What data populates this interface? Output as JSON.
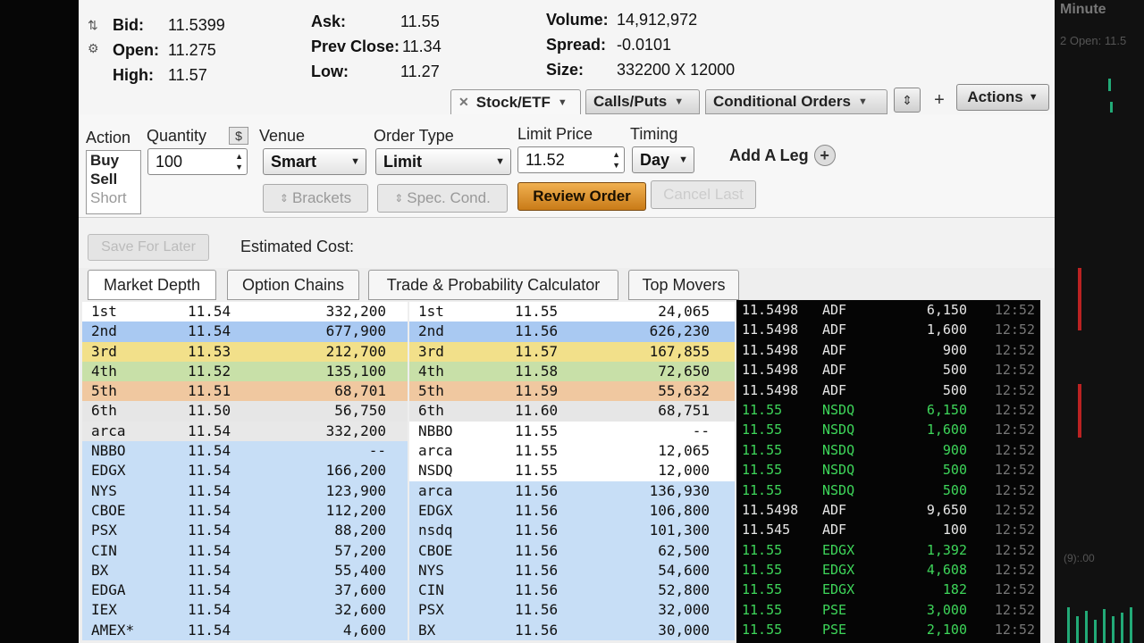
{
  "quote": {
    "bid_label": "Bid:",
    "bid": "11.5399",
    "open_label": "Open:",
    "open": "11.275",
    "high_label": "High:",
    "high": "11.57",
    "ask_label": "Ask:",
    "ask": "11.55",
    "prev_close_label": "Prev Close:",
    "prev_close": "11.34",
    "low_label": "Low:",
    "low": "11.27",
    "volume_label": "Volume:",
    "volume": "14,912,972",
    "spread_label": "Spread:",
    "spread": "-0.0101",
    "size_label": "Size:",
    "size": "332200 X 12000"
  },
  "tabs": {
    "stock_etf": "Stock/ETF",
    "calls_puts": "Calls/Puts",
    "conditional_orders": "Conditional Orders",
    "actions": "Actions"
  },
  "order": {
    "action_label": "Action",
    "quantity_label": "Quantity",
    "venue_label": "Venue",
    "order_type_label": "Order Type",
    "limit_price_label": "Limit Price",
    "timing_label": "Timing",
    "actions": [
      "Buy",
      "Sell",
      "Short"
    ],
    "quantity": "100",
    "venue": "Smart",
    "order_type": "Limit",
    "limit_price": "11.52",
    "timing": "Day",
    "add_leg": "Add A Leg",
    "brackets": "Brackets",
    "spec_cond": "Spec. Cond.",
    "review_order": "Review Order",
    "cancel_last": "Cancel Last",
    "save_for_later": "Save For Later",
    "estimated_cost": "Estimated Cost:"
  },
  "tool_tabs": [
    "Market Depth",
    "Option Chains",
    "Trade & Probability Calculator",
    "Top Movers"
  ],
  "bid_depth": [
    {
      "venue": "1st",
      "price": "11.54",
      "size": "332,200",
      "lvl": "lvl0"
    },
    {
      "venue": "2nd",
      "price": "11.54",
      "size": "677,900",
      "lvl": "lvl1"
    },
    {
      "venue": "3rd",
      "price": "11.53",
      "size": "212,700",
      "lvl": "lvl2"
    },
    {
      "venue": "4th",
      "price": "11.52",
      "size": "135,100",
      "lvl": "lvl3"
    },
    {
      "venue": "5th",
      "price": "11.51",
      "size": "68,701",
      "lvl": "lvl4"
    },
    {
      "venue": "6th",
      "price": "11.50",
      "size": "56,750",
      "lvl": "lvl5"
    },
    {
      "venue": "arca",
      "price": "11.54",
      "size": "332,200",
      "lvl": "ex-first"
    },
    {
      "venue": "NBBO",
      "price": "11.54",
      "size": "--",
      "lvl": "ex-bg"
    },
    {
      "venue": "EDGX",
      "price": "11.54",
      "size": "166,200",
      "lvl": "ex-bg"
    },
    {
      "venue": "NYS",
      "price": "11.54",
      "size": "123,900",
      "lvl": "ex-bg"
    },
    {
      "venue": "CBOE",
      "price": "11.54",
      "size": "112,200",
      "lvl": "ex-bg"
    },
    {
      "venue": "PSX",
      "price": "11.54",
      "size": "88,200",
      "lvl": "ex-bg"
    },
    {
      "venue": "CIN",
      "price": "11.54",
      "size": "57,200",
      "lvl": "ex-bg"
    },
    {
      "venue": "BX",
      "price": "11.54",
      "size": "55,400",
      "lvl": "ex-bg"
    },
    {
      "venue": "EDGA",
      "price": "11.54",
      "size": "37,600",
      "lvl": "ex-bg"
    },
    {
      "venue": "IEX",
      "price": "11.54",
      "size": "32,600",
      "lvl": "ex-bg"
    },
    {
      "venue": "AMEX*",
      "price": "11.54",
      "size": "4,600",
      "lvl": "ex-bg"
    }
  ],
  "ask_depth": [
    {
      "venue": "1st",
      "price": "11.55",
      "size": "24,065",
      "lvl": "lvl0"
    },
    {
      "venue": "2nd",
      "price": "11.56",
      "size": "626,230",
      "lvl": "lvl1"
    },
    {
      "venue": "3rd",
      "price": "11.57",
      "size": "167,855",
      "lvl": "lvl2"
    },
    {
      "venue": "4th",
      "price": "11.58",
      "size": "72,650",
      "lvl": "lvl3"
    },
    {
      "venue": "5th",
      "price": "11.59",
      "size": "55,632",
      "lvl": "lvl4"
    },
    {
      "venue": "6th",
      "price": "11.60",
      "size": "68,751",
      "lvl": "lvl5"
    },
    {
      "venue": "NBBO",
      "price": "11.55",
      "size": "--",
      "lvl": "lvl0"
    },
    {
      "venue": "arca",
      "price": "11.55",
      "size": "12,065",
      "lvl": "lvl0"
    },
    {
      "venue": "NSDQ",
      "price": "11.55",
      "size": "12,000",
      "lvl": "lvl0"
    },
    {
      "venue": "arca",
      "price": "11.56",
      "size": "136,930",
      "lvl": "ex-bg"
    },
    {
      "venue": "EDGX",
      "price": "11.56",
      "size": "106,800",
      "lvl": "ex-bg"
    },
    {
      "venue": "nsdq",
      "price": "11.56",
      "size": "101,300",
      "lvl": "ex-bg"
    },
    {
      "venue": "CBOE",
      "price": "11.56",
      "size": "62,500",
      "lvl": "ex-bg"
    },
    {
      "venue": "NYS",
      "price": "11.56",
      "size": "54,600",
      "lvl": "ex-bg"
    },
    {
      "venue": "CIN",
      "price": "11.56",
      "size": "52,800",
      "lvl": "ex-bg"
    },
    {
      "venue": "PSX",
      "price": "11.56",
      "size": "32,000",
      "lvl": "ex-bg"
    },
    {
      "venue": "BX",
      "price": "11.56",
      "size": "30,000",
      "lvl": "ex-bg"
    }
  ],
  "time_sales": [
    {
      "price": "11.5498",
      "exch": "ADF",
      "size": "6,150",
      "time": "12:52",
      "color": "#e8e8e8"
    },
    {
      "price": "11.5498",
      "exch": "ADF",
      "size": "1,600",
      "time": "12:52",
      "color": "#e8e8e8"
    },
    {
      "price": "11.5498",
      "exch": "ADF",
      "size": "900",
      "time": "12:52",
      "color": "#e8e8e8"
    },
    {
      "price": "11.5498",
      "exch": "ADF",
      "size": "500",
      "time": "12:52",
      "color": "#e8e8e8"
    },
    {
      "price": "11.5498",
      "exch": "ADF",
      "size": "500",
      "time": "12:52",
      "color": "#e8e8e8"
    },
    {
      "price": "11.55",
      "exch": "NSDQ",
      "size": "6,150",
      "time": "12:52",
      "color": "#3ed65a"
    },
    {
      "price": "11.55",
      "exch": "NSDQ",
      "size": "1,600",
      "time": "12:52",
      "color": "#3ed65a"
    },
    {
      "price": "11.55",
      "exch": "NSDQ",
      "size": "900",
      "time": "12:52",
      "color": "#3ed65a"
    },
    {
      "price": "11.55",
      "exch": "NSDQ",
      "size": "500",
      "time": "12:52",
      "color": "#3ed65a"
    },
    {
      "price": "11.55",
      "exch": "NSDQ",
      "size": "500",
      "time": "12:52",
      "color": "#3ed65a"
    },
    {
      "price": "11.5498",
      "exch": "ADF",
      "size": "9,650",
      "time": "12:52",
      "color": "#e8e8e8"
    },
    {
      "price": "11.545",
      "exch": "ADF",
      "size": "100",
      "time": "12:52",
      "color": "#e8e8e8"
    },
    {
      "price": "11.55",
      "exch": "EDGX",
      "size": "1,392",
      "time": "12:52",
      "color": "#3ed65a"
    },
    {
      "price": "11.55",
      "exch": "EDGX",
      "size": "4,608",
      "time": "12:52",
      "color": "#3ed65a"
    },
    {
      "price": "11.55",
      "exch": "EDGX",
      "size": "182",
      "time": "12:52",
      "color": "#3ed65a"
    },
    {
      "price": "11.55",
      "exch": "PSE",
      "size": "3,000",
      "time": "12:52",
      "color": "#3ed65a"
    },
    {
      "price": "11.55",
      "exch": "PSE",
      "size": "2,100",
      "time": "12:52",
      "color": "#3ed65a"
    }
  ],
  "background_window": {
    "title": "Minute",
    "subtitle": "2 Open: 11.5",
    "readout": "(9):.00"
  },
  "icons": {
    "bid_arrows": "up-down-arrows-icon",
    "gear": "gear-icon",
    "close": "close-icon",
    "plus": "plus-icon"
  }
}
